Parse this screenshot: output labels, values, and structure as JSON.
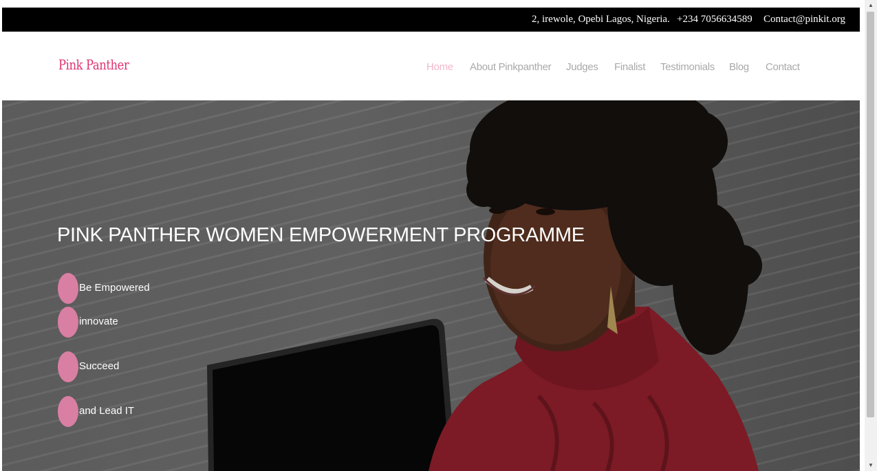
{
  "topbar": {
    "address": "2, irewole, Opebi Lagos, Nigeria.",
    "phone": "+234 7056634589",
    "email": "Contact@pinkit.org"
  },
  "header": {
    "logo": "Pink Panther",
    "nav": [
      {
        "label": "Home",
        "active": true
      },
      {
        "label": "About Pinkpanther"
      },
      {
        "label": "Judges"
      },
      {
        "label": "Finalist"
      },
      {
        "label": "Testimonials"
      },
      {
        "label": "Blog"
      },
      {
        "label": "Contact"
      }
    ]
  },
  "hero": {
    "title": "PINK PANTHER WOMEN EMPOWERMENT PROGRAMME",
    "bullets": [
      "Be Empowered",
      "innovate",
      "Succeed",
      "and Lead IT"
    ]
  },
  "colors": {
    "topbar_bg": "#000000",
    "logo": "#e0306f",
    "nav_active": "#f2b8cc",
    "nav_text": "#a9a9a9",
    "bullet": "#d97fa3",
    "sweater": "#8e1f2b"
  },
  "icons": {
    "scroll_up": "triangle-up-icon",
    "scroll_down": "triangle-down-icon"
  }
}
